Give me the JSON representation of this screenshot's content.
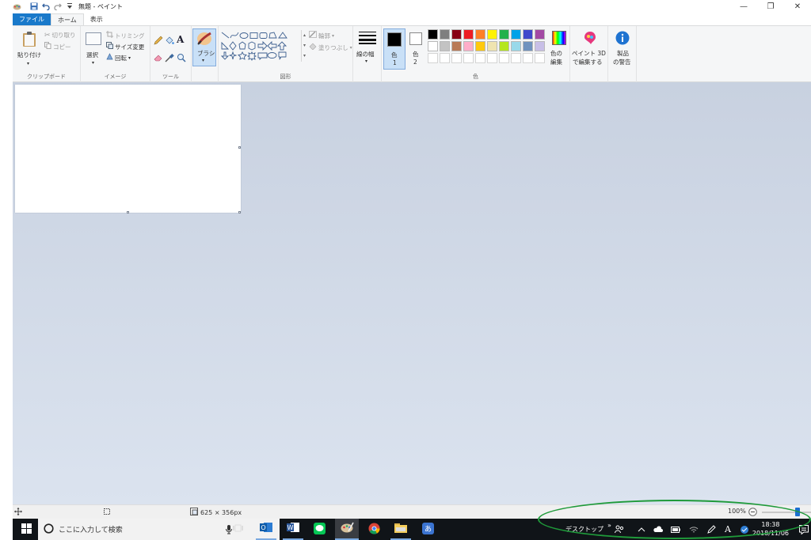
{
  "window": {
    "title": "無題 - ペイント",
    "min_label": "—",
    "restore_label": "❐",
    "close_label": "✕"
  },
  "tabs": [
    {
      "label": "ファイル"
    },
    {
      "label": "ホーム"
    },
    {
      "label": "表示"
    }
  ],
  "ribbon": {
    "clipboard": {
      "paste": "貼り付け",
      "cut": "切り取り",
      "copy": "コピー",
      "group_label": "クリップボード"
    },
    "image": {
      "select": "選択",
      "crop": "トリミング",
      "resize": "サイズ変更",
      "rotate": "回転",
      "group_label": "イメージ"
    },
    "tools": {
      "group_label": "ツール"
    },
    "brush": {
      "label": "ブラシ"
    },
    "shapes": {
      "outline": "輪郭",
      "fill": "塗りつぶし",
      "group_label": "図形"
    },
    "size": {
      "label": "線の幅"
    },
    "colors": {
      "color1_line1": "色",
      "color1_line2": "1",
      "color2_line1": "色",
      "color2_line2": "2",
      "edit_line1": "色の",
      "edit_line2": "編集",
      "group_label": "色",
      "row1": [
        "#000000",
        "#7f7f7f",
        "#880015",
        "#ed1c24",
        "#ff7f27",
        "#fff200",
        "#22b14c",
        "#00a2e8",
        "#3f48cc",
        "#a349a4"
      ],
      "row2": [
        "#ffffff",
        "#c3c3c3",
        "#b97a57",
        "#ffaec9",
        "#ffc90e",
        "#efe4b0",
        "#b5e61d",
        "#99d9ea",
        "#7092be",
        "#c8bfe7"
      ],
      "row3": [
        "#ffffff",
        "#ffffff",
        "#ffffff",
        "#ffffff",
        "#ffffff",
        "#ffffff",
        "#ffffff",
        "#ffffff",
        "#ffffff",
        "#ffffff"
      ]
    },
    "paint3d": {
      "line1": "ペイント 3D",
      "line2": "で編集する"
    },
    "product_alert": {
      "line1": "製品",
      "line2": "の警告"
    }
  },
  "status": {
    "canvas_size": "625 × 356px",
    "zoom": "100%",
    "zoom_level_percent": 100
  },
  "taskbar": {
    "search_placeholder": "ここに入力して検索",
    "desktop_label": "デスクトップ",
    "chevron": "»",
    "time": "18:38",
    "date": "2018/11/06"
  }
}
